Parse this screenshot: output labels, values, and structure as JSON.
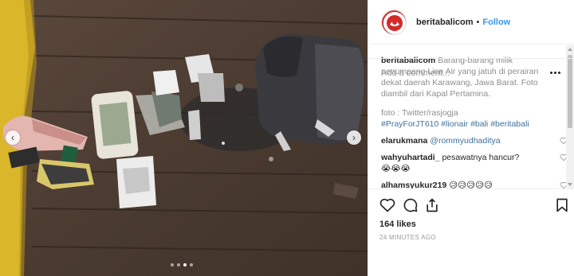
{
  "header": {
    "username": "beritabalicom",
    "separator": "•",
    "follow_label": "Follow"
  },
  "caption": {
    "username": "beritabalicom",
    "text": "Barang-barang milik penumpang Lion Air yang jatuh di perairan dekat daerah Karawang, Jawa Barat. Foto diambil dari Kapal Pertamina.",
    "credit": "foto : Twitter/rasjogja",
    "hashtags": [
      "#PrayForJT610",
      "#lionair",
      "#bali",
      "#beritabali"
    ]
  },
  "comments": [
    {
      "username": "elarukmana",
      "mention": "@rommyudhaditya",
      "text": ""
    },
    {
      "username": "wahyuhartadi_",
      "mention": "",
      "text": "pesawatnya hancur?",
      "emoji": "😭😭😭"
    },
    {
      "username": "alhamsyukur219",
      "mention": "",
      "text": "",
      "emoji": "😥😥😥😥😥"
    }
  ],
  "likes": "164 likes",
  "timestamp": "24 MINUTES AGO",
  "add_comment_placeholder": "Add a comment...",
  "carousel": {
    "total_slides": 4,
    "active_slide": 3
  },
  "icons": [
    "heart-icon",
    "comment-icon",
    "share-icon",
    "bookmark-icon",
    "more-options-icon",
    "chevron-left-icon",
    "chevron-right-icon"
  ],
  "colors": {
    "link": "#3897f0",
    "hashtag": "#3f729b",
    "meta": "#999999",
    "avatar_red": "#d42a2a"
  }
}
